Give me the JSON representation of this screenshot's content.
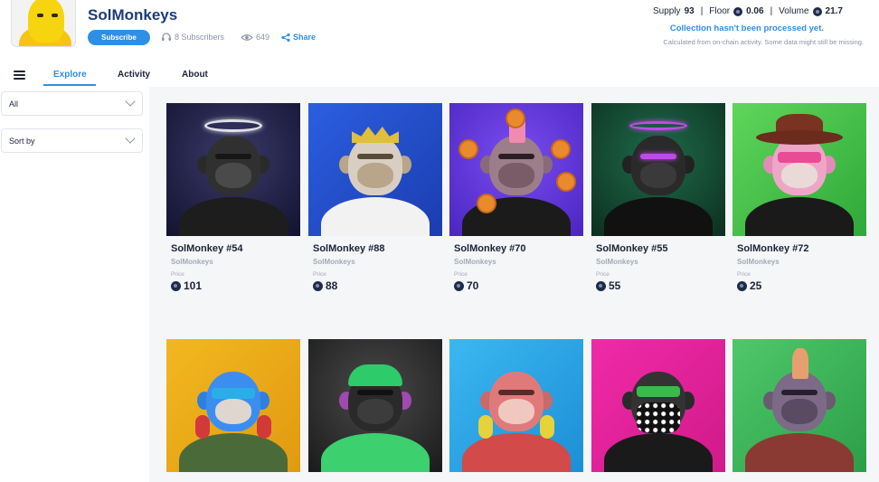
{
  "header": {
    "collection_name": "SolMonkeys",
    "subscribe_label": "Subscribe",
    "subscribers": "8 Subscribers",
    "views": "649",
    "share_label": "Share",
    "stats": {
      "supply_label": "Supply",
      "supply_value": "93",
      "floor_label": "Floor",
      "floor_value": "0.06",
      "volume_label": "Volume",
      "volume_value": "21.7"
    },
    "processing_notice": "Collection hasn't been processed yet.",
    "disclaimer": "Calculated from on-chain activity. Some data might still be missing."
  },
  "tabs": [
    {
      "label": "Explore",
      "active": true
    },
    {
      "label": "Activity",
      "active": false
    },
    {
      "label": "About",
      "active": false
    }
  ],
  "filters": {
    "category_selected": "All",
    "sort_selected": "Sort by"
  },
  "price_label": "Price",
  "collection_label": "SolMonkeys",
  "items": [
    {
      "name": "SolMonkey #54",
      "price": "101"
    },
    {
      "name": "SolMonkey #88",
      "price": "88"
    },
    {
      "name": "SolMonkey #70",
      "price": "70"
    },
    {
      "name": "SolMonkey #55",
      "price": "55"
    },
    {
      "name": "SolMonkey #72",
      "price": "25"
    }
  ],
  "colors": {
    "accent": "#2f8fe6",
    "title": "#1c3b7a",
    "text": "#1b2437",
    "muted": "#8a93a4"
  }
}
